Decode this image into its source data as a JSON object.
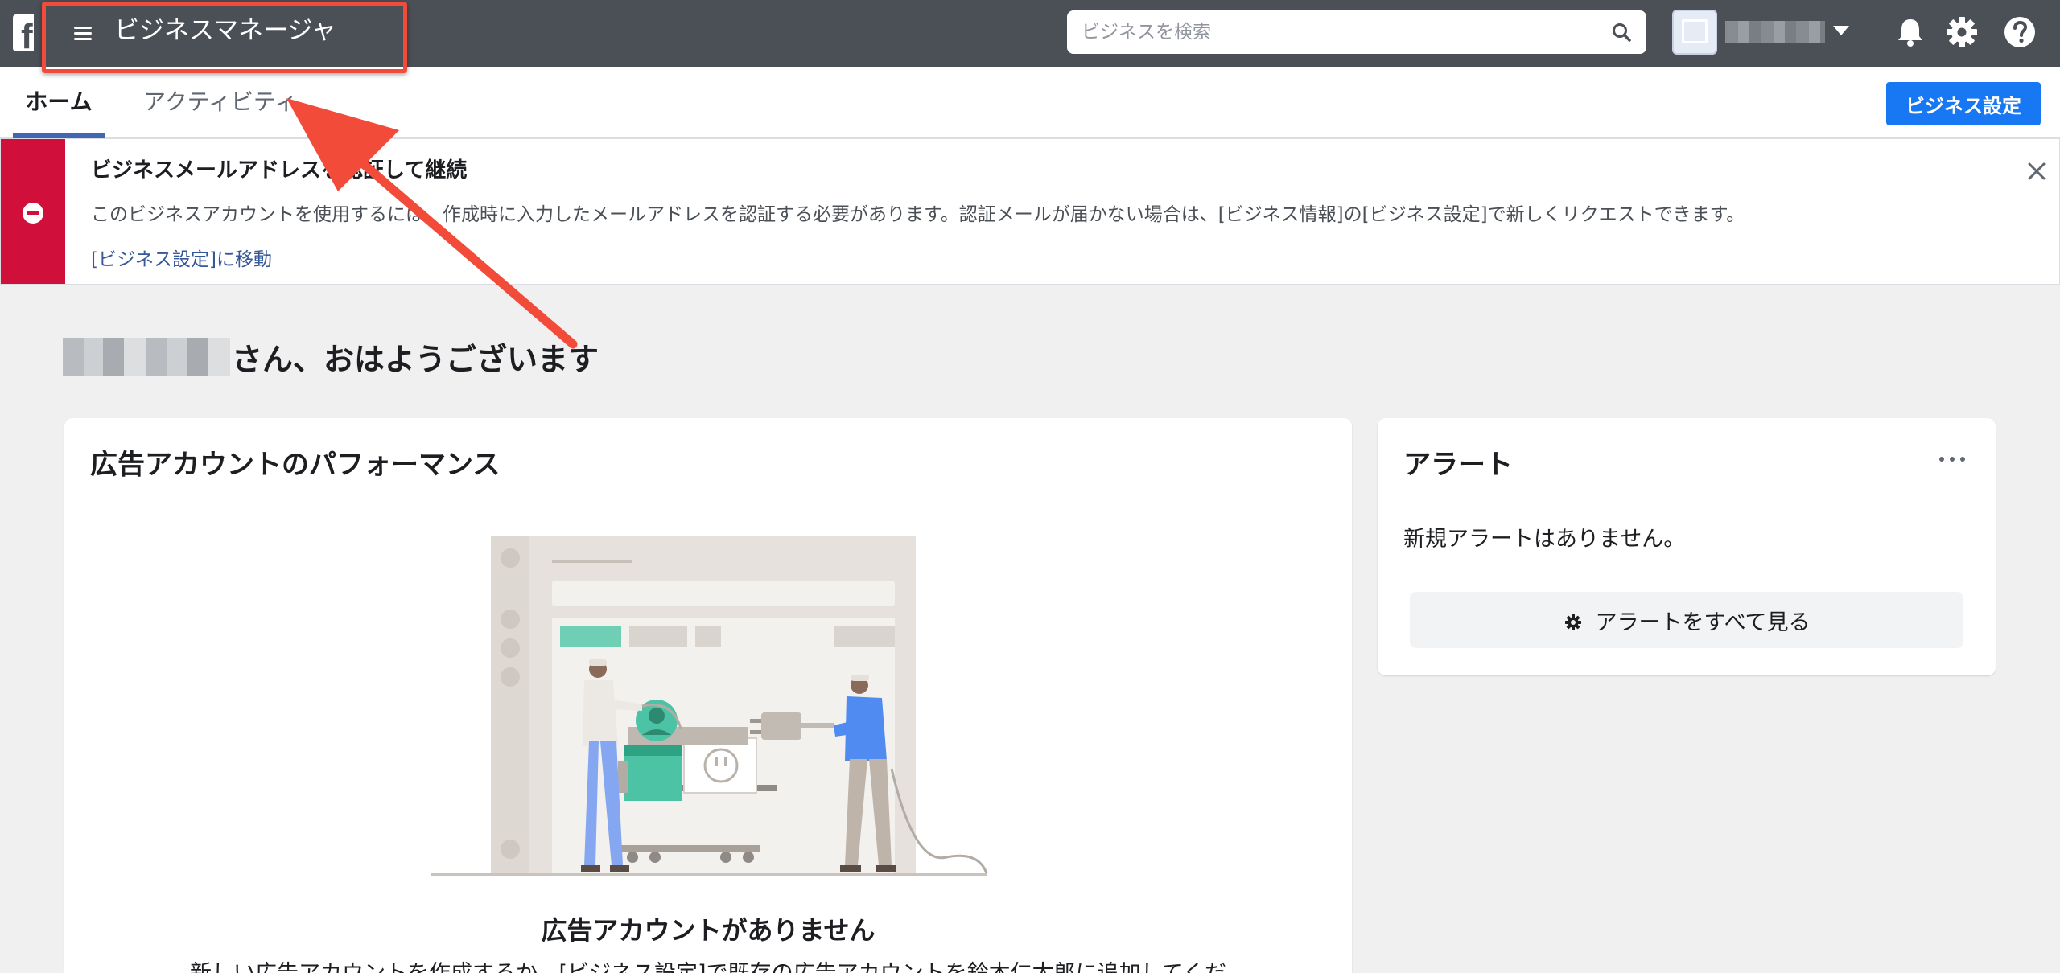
{
  "topbar": {
    "app_title": "ビジネスマネージャ",
    "search_placeholder": "ビジネスを検索",
    "bg_color": "#4b4f56"
  },
  "tabs": [
    {
      "label": "ホーム",
      "active": true
    },
    {
      "label": "アクティビティ",
      "active": false
    }
  ],
  "toolbar": {
    "settings_label": "ビジネス設定",
    "accent_color": "#1877f2"
  },
  "banner": {
    "title": "ビジネスメールアドレスを認証して継続",
    "body": "このビジネスアカウントを使用するには、作成時に入力したメールアドレスを認証する必要があります。認証メールが届かない場合は、[ビジネス情報]の[ビジネス設定]で新しくリクエストできます。",
    "link": "[ビジネス設定]に移動",
    "status_color": "#d0103a"
  },
  "greeting": {
    "text": "さん、おはようございます"
  },
  "performance": {
    "title": "広告アカウントのパフォーマンス",
    "empty_title": "広告アカウントがありません",
    "empty_body": "新しい広告アカウントを作成するか、[ビジネス設定]で既存の広告アカウントを鈴木仁太郎に追加してくだ"
  },
  "alerts": {
    "title": "アラート",
    "empty_text": "新規アラートはありません。",
    "see_all_label": "アラートをすべて見る"
  },
  "icons": {
    "menu": "menu-icon",
    "search": "search-icon",
    "notifications": "bell-icon",
    "settings": "gear-icon",
    "help": "help-icon",
    "close": "close-icon",
    "error": "minus-circle-icon",
    "more": "more-icon"
  },
  "annotation": {
    "highlight_color": "#f24b3a"
  }
}
